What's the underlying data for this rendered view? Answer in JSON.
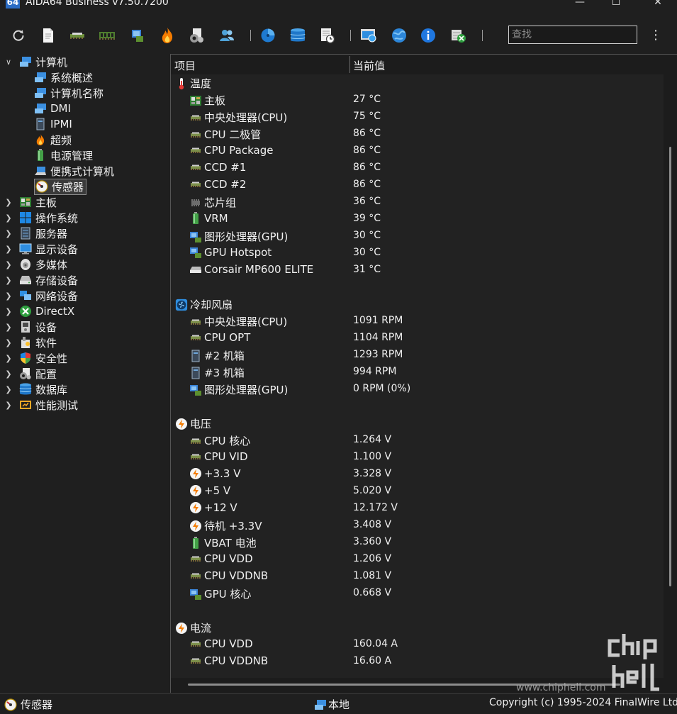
{
  "app": {
    "logo_text": "64",
    "title": "AIDA64 Business v7.50.7200"
  },
  "window_controls": {
    "minimize": "—",
    "maximize": "☐",
    "close": "✕"
  },
  "toolbar": {
    "buttons": [
      "refresh-icon",
      "report-icon",
      "motherboard-icon",
      "memory-icon",
      "gpu-icon",
      "overclock-icon",
      "config-icon",
      "user-icon",
      "disk-icon",
      "database-icon",
      "schedule-icon",
      "network-monitor-icon",
      "network-icon",
      "info-icon",
      "excel-icon"
    ],
    "search_placeholder": "查找",
    "menu": "⋮"
  },
  "tree": {
    "root": {
      "label": "计算机"
    },
    "children": [
      {
        "label": "系统概述",
        "icon": "computer-icon"
      },
      {
        "label": "计算机名称",
        "icon": "computer-icon"
      },
      {
        "label": "DMI",
        "icon": "computer-icon"
      },
      {
        "label": "IPMI",
        "icon": "tower-icon"
      },
      {
        "label": "超频",
        "icon": "flame-icon"
      },
      {
        "label": "电源管理",
        "icon": "battery-icon"
      },
      {
        "label": "便携式计算机",
        "icon": "laptop-icon"
      },
      {
        "label": "传感器",
        "icon": "sensor-icon",
        "selected": true
      }
    ],
    "top_items": [
      {
        "label": "主板",
        "icon": "motherboard-icon"
      },
      {
        "label": "操作系统",
        "icon": "windows-icon"
      },
      {
        "label": "服务器",
        "icon": "server-icon"
      },
      {
        "label": "显示设备",
        "icon": "monitor-icon"
      },
      {
        "label": "多媒体",
        "icon": "speaker-icon"
      },
      {
        "label": "存储设备",
        "icon": "drive-icon"
      },
      {
        "label": "网络设备",
        "icon": "network-icon"
      },
      {
        "label": "DirectX",
        "icon": "xbox-icon"
      },
      {
        "label": "设备",
        "icon": "device-icon"
      },
      {
        "label": "软件",
        "icon": "software-icon"
      },
      {
        "label": "安全性",
        "icon": "shield-icon"
      },
      {
        "label": "配置",
        "icon": "config-icon"
      },
      {
        "label": "数据库",
        "icon": "database-icon"
      },
      {
        "label": "性能测试",
        "icon": "benchmark-icon"
      }
    ]
  },
  "table": {
    "columns": [
      "项目",
      "当前值"
    ],
    "groups": [
      {
        "title": "温度",
        "icon": "thermometer-icon",
        "rows": [
          {
            "name": "主板",
            "value": "27 °C",
            "icon": "motherboard-icon"
          },
          {
            "name": "中央处理器(CPU)",
            "value": "75 °C",
            "icon": "cpu-icon"
          },
          {
            "name": "CPU 二极管",
            "value": "86 °C",
            "icon": "cpu-icon"
          },
          {
            "name": "CPU Package",
            "value": "86 °C",
            "icon": "cpu-icon"
          },
          {
            "name": "CCD #1",
            "value": "86 °C",
            "icon": "cpu-icon"
          },
          {
            "name": "CCD #2",
            "value": "86 °C",
            "icon": "cpu-icon"
          },
          {
            "name": "芯片组",
            "value": "36 °C",
            "icon": "chip-icon"
          },
          {
            "name": "VRM",
            "value": "39 °C",
            "icon": "battery-icon"
          },
          {
            "name": "图形处理器(GPU)",
            "value": "30 °C",
            "icon": "gpu-icon"
          },
          {
            "name": "GPU Hotspot",
            "value": "30 °C",
            "icon": "gpu-icon"
          },
          {
            "name": "Corsair MP600 ELITE",
            "value": "31 °C",
            "icon": "ssd-icon"
          }
        ]
      },
      {
        "title": "冷却风扇",
        "icon": "fan-icon",
        "rows": [
          {
            "name": "中央处理器(CPU)",
            "value": "1091 RPM",
            "icon": "cpu-icon"
          },
          {
            "name": "CPU OPT",
            "value": "1104 RPM",
            "icon": "cpu-icon"
          },
          {
            "name": "#2 机箱",
            "value": "1293 RPM",
            "icon": "tower-icon"
          },
          {
            "name": "#3 机箱",
            "value": "994 RPM",
            "icon": "tower-icon"
          },
          {
            "name": "图形处理器(GPU)",
            "value": "0 RPM  (0%)",
            "icon": "gpu-icon"
          }
        ]
      },
      {
        "title": "电压",
        "icon": "voltage-icon",
        "rows": [
          {
            "name": "CPU 核心",
            "value": "1.264 V",
            "icon": "cpu-icon"
          },
          {
            "name": "CPU VID",
            "value": "1.100 V",
            "icon": "cpu-icon"
          },
          {
            "name": "+3.3 V",
            "value": "3.328 V",
            "icon": "voltage-icon"
          },
          {
            "name": "+5 V",
            "value": "5.020 V",
            "icon": "voltage-icon"
          },
          {
            "name": "+12 V",
            "value": "12.172 V",
            "icon": "voltage-icon"
          },
          {
            "name": "待机 +3.3V",
            "value": "3.408 V",
            "icon": "voltage-icon"
          },
          {
            "name": "VBAT 电池",
            "value": "3.360 V",
            "icon": "battery-icon"
          },
          {
            "name": "CPU VDD",
            "value": "1.206 V",
            "icon": "cpu-icon"
          },
          {
            "name": "CPU VDDNB",
            "value": "1.081 V",
            "icon": "cpu-icon"
          },
          {
            "name": "GPU 核心",
            "value": "0.668 V",
            "icon": "gpu-icon"
          }
        ]
      },
      {
        "title": "电流",
        "icon": "voltage-icon",
        "rows": [
          {
            "name": "CPU VDD",
            "value": "160.04 A",
            "icon": "cpu-icon"
          },
          {
            "name": "CPU VDDNB",
            "value": "16.60 A",
            "icon": "cpu-icon"
          }
        ]
      }
    ]
  },
  "status": {
    "left": "传感器",
    "center": "本地",
    "right": "Copyright (c) 1995-2024 FinalWire Ltd."
  },
  "watermark": {
    "site": "www.chiphell.com",
    "logo_text": "chip hell"
  }
}
